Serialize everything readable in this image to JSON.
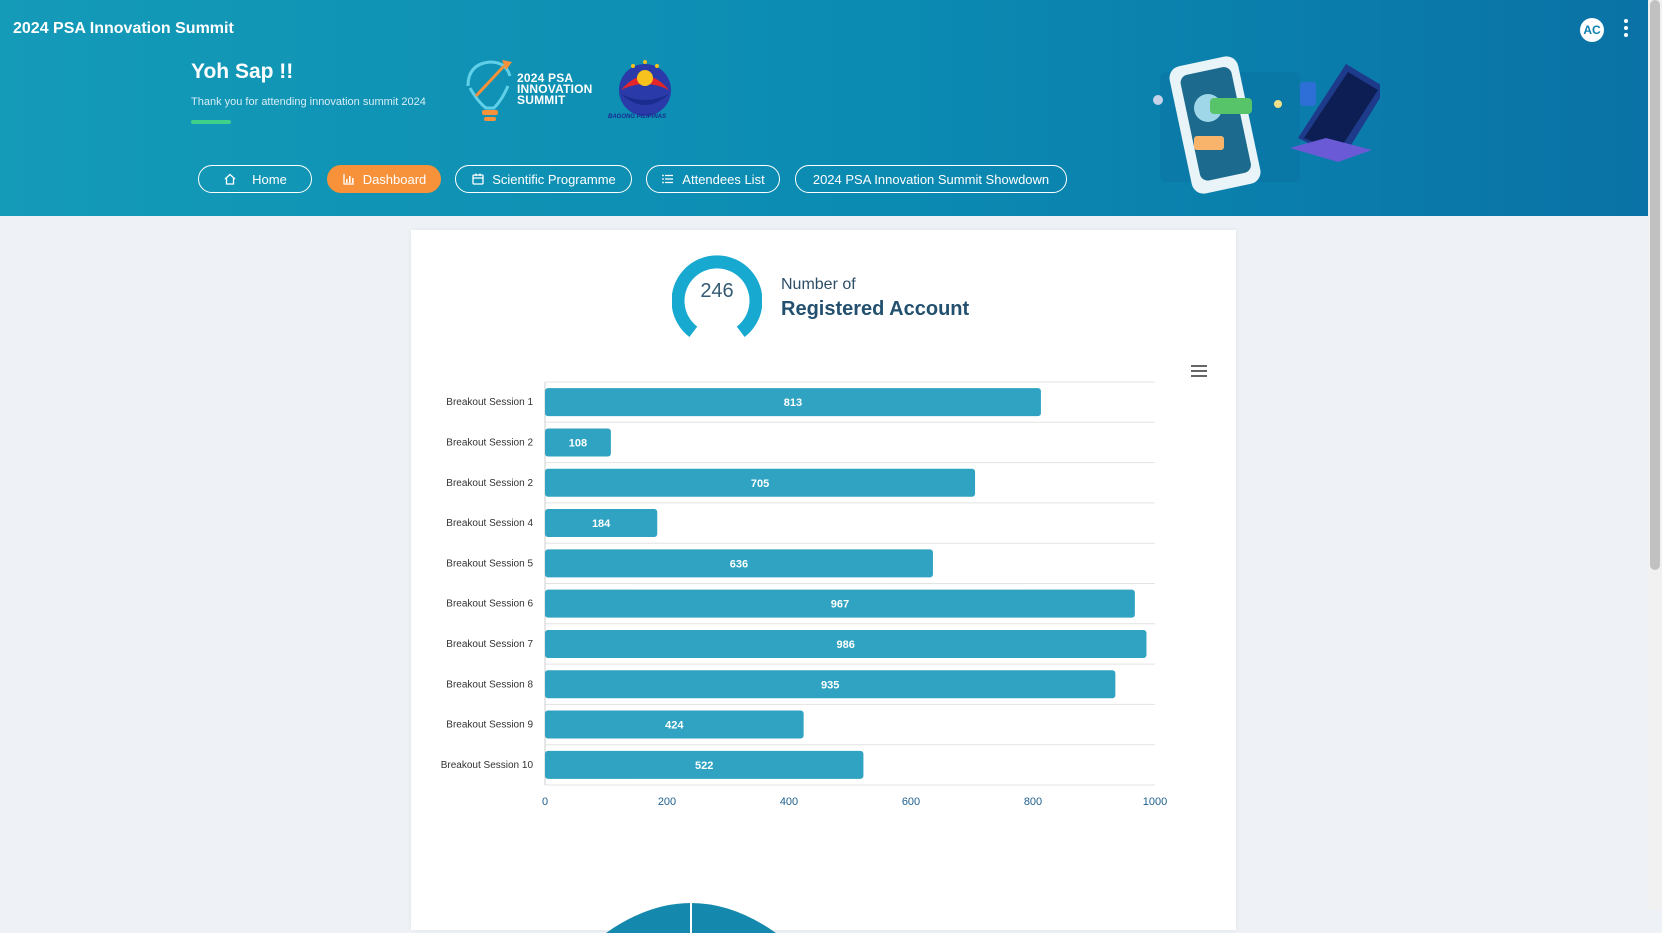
{
  "app": {
    "title": "2024 PSA Innovation Summit",
    "avatar_initials": "AC"
  },
  "hero": {
    "greeting": "Yoh Sap !!",
    "subtitle": "Thank you for attending innovation summit 2024",
    "logo_text": [
      "2024 PSA",
      "INNOVATION",
      "SUMMIT"
    ],
    "bagong_text": "BAGONG PILIPINAS"
  },
  "nav": [
    {
      "label": "Home",
      "icon": "home-icon",
      "active": false
    },
    {
      "label": "Dashboard",
      "icon": "bar-chart-icon",
      "active": true
    },
    {
      "label": "Scientific Programme",
      "icon": "calendar-icon",
      "active": false
    },
    {
      "label": "Attendees List",
      "icon": "list-icon",
      "active": false
    },
    {
      "label": "2024 PSA Innovation Summit Showdown",
      "icon": "",
      "active": false
    }
  ],
  "metric": {
    "value": "246",
    "label_top": "Number of",
    "label_main": "Registered Account"
  },
  "colors": {
    "accent": "#2fa3c1",
    "orange": "#f7913a",
    "axis": "#1d5f8c"
  },
  "chart_data": {
    "type": "bar",
    "orientation": "horizontal",
    "categories": [
      "Breakout Session 1",
      "Breakout Session 2",
      "Breakout Session 2",
      "Breakout Session 4",
      "Breakout Session 5",
      "Breakout Session 6",
      "Breakout Session 7",
      "Breakout Session 8",
      "Breakout Session 9",
      "Breakout Session 10"
    ],
    "values": [
      813,
      108,
      705,
      184,
      636,
      967,
      986,
      935,
      424,
      522
    ],
    "xlim": [
      0,
      1000
    ],
    "xticks": [
      0,
      200,
      400,
      600,
      800,
      1000
    ],
    "data_labels": true,
    "grid": true
  }
}
